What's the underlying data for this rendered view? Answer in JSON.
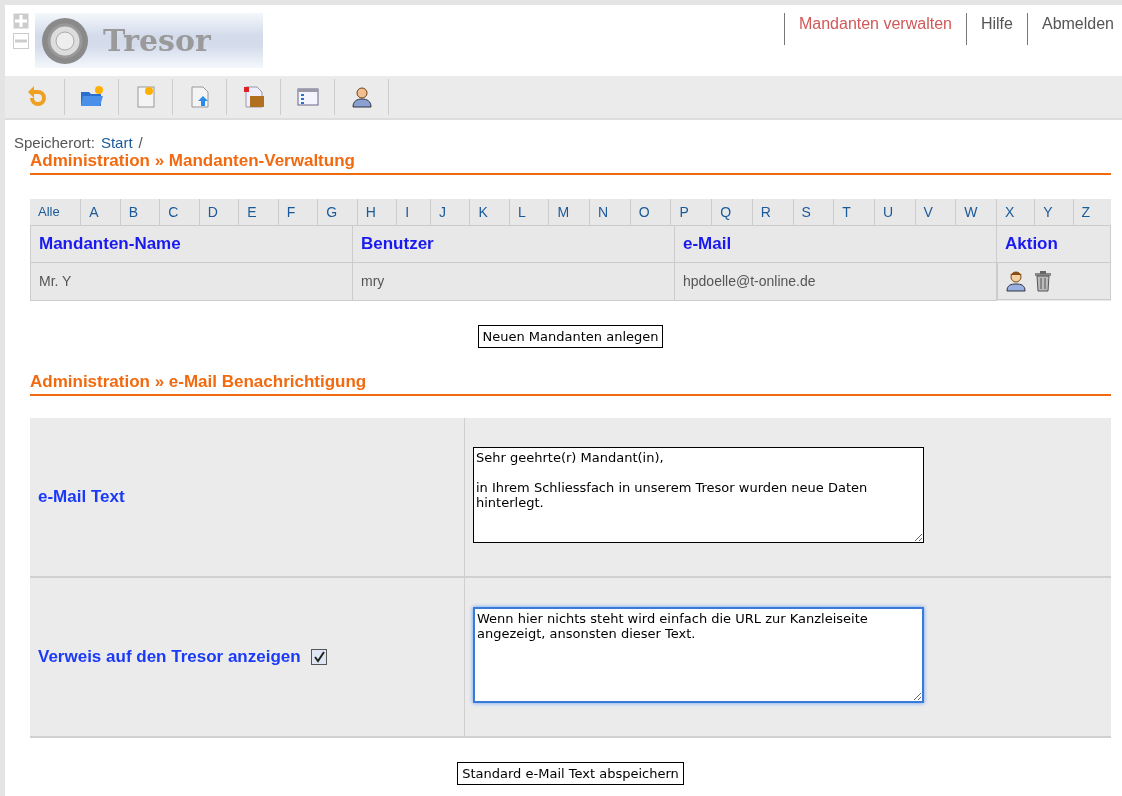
{
  "nav": [
    {
      "label": "Mandanten verwalten",
      "selected": true
    },
    {
      "label": "Hilfe",
      "selected": false
    },
    {
      "label": "Abmelden",
      "selected": false
    }
  ],
  "logo": {
    "text": "Tresor"
  },
  "breadcrumb": {
    "label": "Speicherort:",
    "link": "Start",
    "separator": "/"
  },
  "section1": {
    "title": "Administration » Mandanten-Verwaltung"
  },
  "letters": [
    "Alle",
    "A",
    "B",
    "C",
    "D",
    "E",
    "F",
    "G",
    "H",
    "I",
    "J",
    "K",
    "L",
    "M",
    "N",
    "O",
    "P",
    "Q",
    "R",
    "S",
    "T",
    "U",
    "V",
    "W",
    "X",
    "Y",
    "Z"
  ],
  "table": {
    "columns": [
      "Mandanten-Name",
      "Benutzer",
      "e-Mail",
      "Aktion"
    ],
    "rows": [
      {
        "name": "Mr. Y",
        "user": "mry",
        "email": "hpdoelle@t-online.de"
      }
    ]
  },
  "new_button": "Neuen Mandanten anlegen",
  "section2": {
    "title": "Administration » e-Mail Benachrichtigung"
  },
  "form": [
    {
      "kind": "text",
      "label": "e-Mail Text",
      "value": "Sehr geehrte(r) Mandant(in),\n\nin Ihrem Schliessfach in unserem Tresor wurden neue Daten hinterlegt.",
      "focused": false
    },
    {
      "kind": "checkbox",
      "label": "Verweis auf den Tresor anzeigen",
      "checked": true,
      "value": "Wenn hier nichts steht wird einfach die URL zur Kanzleiseite angezeigt, ansonsten dieser Text.",
      "focused": true
    }
  ],
  "save_button": "Standard e-Mail Text abspeichern"
}
